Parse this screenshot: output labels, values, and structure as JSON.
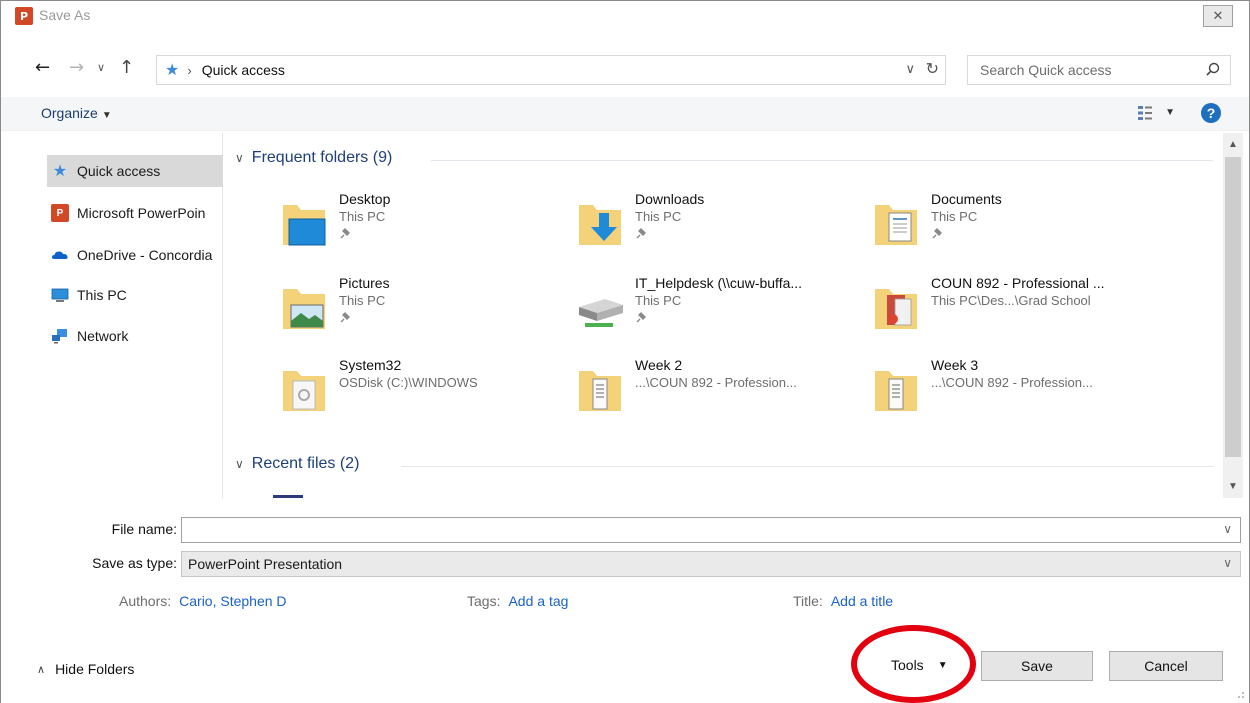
{
  "window": {
    "title": "Save As",
    "app_icon_text": "P",
    "close_symbol": "✕"
  },
  "address_bar": {
    "location": "Quick access",
    "search_placeholder": "Search Quick access"
  },
  "toolbar": {
    "organize_label": "Organize",
    "help_symbol": "?"
  },
  "sidebar": {
    "items": [
      {
        "label": "Quick access",
        "icon": "star-icon",
        "active": true
      },
      {
        "label": "Microsoft PowerPoin",
        "icon": "powerpoint-icon"
      },
      {
        "label": "OneDrive - Concordia",
        "icon": "onedrive-icon"
      },
      {
        "label": "This PC",
        "icon": "computer-icon"
      },
      {
        "label": "Network",
        "icon": "network-icon"
      }
    ]
  },
  "content": {
    "frequent_header": "Frequent folders (9)",
    "recent_header": "Recent files (2)",
    "folders": [
      {
        "name": "Desktop",
        "location": "This PC",
        "icon": "desktop-folder-icon",
        "pinned": true
      },
      {
        "name": "Downloads",
        "location": "This PC",
        "icon": "downloads-folder-icon",
        "pinned": true
      },
      {
        "name": "Documents",
        "location": "This PC",
        "icon": "documents-folder-icon",
        "pinned": true
      },
      {
        "name": "Pictures",
        "location": "This PC",
        "icon": "pictures-folder-icon",
        "pinned": true
      },
      {
        "name": "IT_Helpdesk (\\\\cuw-buffa...",
        "location": "This PC",
        "icon": "network-drive-icon",
        "pinned": true
      },
      {
        "name": "COUN 892 - Professional ...",
        "location": "This PC\\Des...\\Grad School",
        "icon": "folder-icon",
        "pinned": false
      },
      {
        "name": "System32",
        "location": "OSDisk (C:)\\WINDOWS",
        "icon": "system-folder-icon",
        "pinned": false
      },
      {
        "name": "Week 2",
        "location": "...\\COUN 892 - Profession...",
        "icon": "folder-icon",
        "pinned": false
      },
      {
        "name": "Week 3",
        "location": "...\\COUN 892 - Profession...",
        "icon": "folder-icon",
        "pinned": false
      }
    ]
  },
  "form": {
    "file_name_label": "File name:",
    "file_name_value": "",
    "save_type_label": "Save as type:",
    "save_type_value": "PowerPoint Presentation",
    "authors_label": "Authors:",
    "authors_value": "Cario, Stephen D",
    "tags_label": "Tags:",
    "tags_value": "Add a tag",
    "title_label": "Title:",
    "title_value": "Add a title"
  },
  "footer": {
    "hide_folders_label": "Hide Folders",
    "tools_label": "Tools",
    "save_label": "Save",
    "cancel_label": "Cancel"
  },
  "colors": {
    "accent_blue": "#1e3f7a",
    "link_blue": "#1a62c7",
    "powerpoint_orange": "#d24726",
    "highlight_ring": "#e3000f"
  }
}
